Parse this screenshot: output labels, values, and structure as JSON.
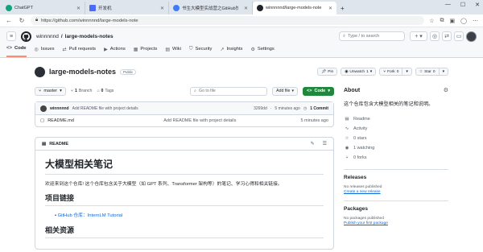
{
  "browser": {
    "tabs": [
      {
        "label": "ChatGPT",
        "fav_color": "#10a37f"
      },
      {
        "label": "开发机",
        "fav_color": "#4a6cf7"
      },
      {
        "label": "书生大模型实战营之GitHub快速入门",
        "fav_color": "#3e7bfa"
      },
      {
        "label": "winnnnnd/large-models-note",
        "fav_color": "#1f2328"
      }
    ],
    "url": "https://github.com/winnnnnd/large-models-note"
  },
  "header": {
    "owner": "winnnnnd",
    "separator": "/",
    "repo": "large-models-notes",
    "search_placeholder": "Type / to search",
    "plus": "+ ▾"
  },
  "reponav": {
    "tabs": [
      {
        "label": "Code",
        "icon": "<>"
      },
      {
        "label": "Issues",
        "icon": "◎"
      },
      {
        "label": "Pull requests",
        "icon": "⇄"
      },
      {
        "label": "Actions",
        "icon": "▶"
      },
      {
        "label": "Projects",
        "icon": "▦"
      },
      {
        "label": "Wiki",
        "icon": "▤"
      },
      {
        "label": "Security",
        "icon": "⛉"
      },
      {
        "label": "Insights",
        "icon": "↗"
      },
      {
        "label": "Settings",
        "icon": "⚙"
      }
    ]
  },
  "title": {
    "name": "large-models-notes",
    "visibility": "Public",
    "pin": "Pin",
    "unwatch": "Unwatch",
    "unwatch_count": "1",
    "fork": "Fork",
    "fork_count": "0",
    "star": "Star",
    "star_count": "0"
  },
  "toolbar": {
    "branch": "master",
    "branches_count": "1",
    "branches_label": "Branch",
    "tags_count": "0",
    "tags_label": "Tags",
    "goto_placeholder": "Go to file",
    "add_file": "Add file",
    "code": "Code"
  },
  "commit": {
    "user": "winnnnnd",
    "message": "Add README file with project details",
    "hash": "3269dd",
    "dot": "·",
    "time": "5 minutes ago",
    "count": "1 Commit"
  },
  "files": [
    {
      "name": "README.md",
      "message": "Add README file with project details",
      "time": "5 minutes ago"
    }
  ],
  "readme": {
    "label": "README",
    "h1": "大模型相关笔记",
    "intro": "欢迎来到这个仓库! 这个仓库包含关于大模型（如 GPT 系列、Transformer 架构等）的笔记、学习心得和相关链接。",
    "h2_links": "项目链接",
    "link_text": "GitHub 仓库：InternLM Tutorial",
    "h2_resources": "相关资源"
  },
  "about": {
    "title": "About",
    "description": "这个仓库包含大模型相关的笔记和说明。",
    "stats": [
      {
        "icon": "book-icon",
        "glyph": "▤",
        "label": "Readme"
      },
      {
        "icon": "activity-icon",
        "glyph": "∿",
        "label": "Activity"
      },
      {
        "icon": "star-icon",
        "glyph": "☆",
        "label": "0 stars"
      },
      {
        "icon": "eye-icon",
        "glyph": "◉",
        "label": "1 watching"
      },
      {
        "icon": "fork-icon",
        "glyph": "⑂",
        "label": "0 forks"
      }
    ]
  },
  "releases": {
    "title": "Releases",
    "none": "No releases published",
    "link": "Create a new release"
  },
  "packages": {
    "title": "Packages",
    "none": "No packages published",
    "link": "Publish your first package"
  },
  "colors": {
    "code_button": "#1f883d",
    "link": "#0969da",
    "active_tab_underline": "#fd8c73"
  }
}
